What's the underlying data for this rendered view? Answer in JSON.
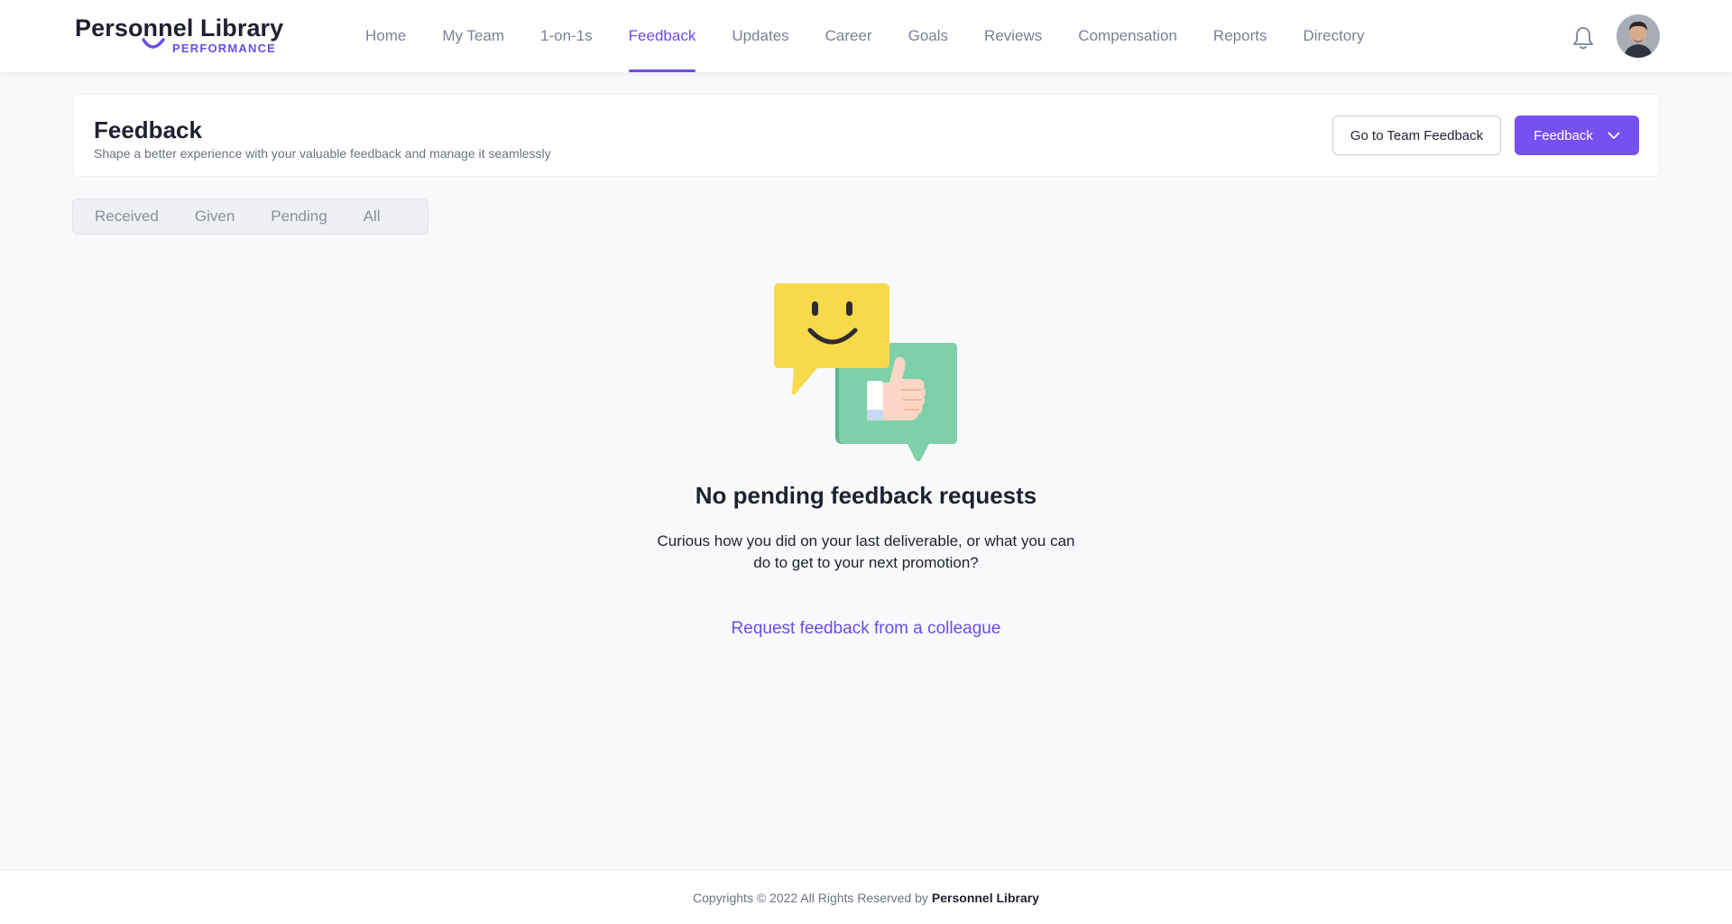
{
  "brand": {
    "name": "Personnel Library",
    "subtitle": "PERFORMANCE",
    "accent_color": "#6d4ce6"
  },
  "nav": {
    "items": [
      {
        "label": "Home",
        "active": false
      },
      {
        "label": "My Team",
        "active": false
      },
      {
        "label": "1-on-1s",
        "active": false
      },
      {
        "label": "Feedback",
        "active": true
      },
      {
        "label": "Updates",
        "active": false
      },
      {
        "label": "Career",
        "active": false
      },
      {
        "label": "Goals",
        "active": false
      },
      {
        "label": "Reviews",
        "active": false
      },
      {
        "label": "Compensation",
        "active": false
      },
      {
        "label": "Reports",
        "active": false
      },
      {
        "label": "Directory",
        "active": false
      }
    ],
    "notification_icon": "bell-icon",
    "avatar_icon": "user-avatar"
  },
  "header": {
    "title": "Feedback",
    "subtitle": "Shape a better experience with your valuable feedback and manage it seamlessly",
    "team_feedback_button": "Go to Team Feedback",
    "feedback_button": "Feedback",
    "feedback_button_icon": "chevron-down-icon"
  },
  "tabs": [
    {
      "label": "Received"
    },
    {
      "label": "Given"
    },
    {
      "label": "Pending"
    },
    {
      "label": "All"
    }
  ],
  "empty_state": {
    "illustration_icon": "feedback-chat-bubbles-icon",
    "title": "No pending feedback requests",
    "description": "Curious how you did on your last deliverable, or what you can do to get to your next promotion?",
    "link": "Request feedback from a colleague"
  },
  "footer": {
    "text": "Copyrights © 2022 All Rights Reserved by",
    "brand": "Personnel Library"
  }
}
